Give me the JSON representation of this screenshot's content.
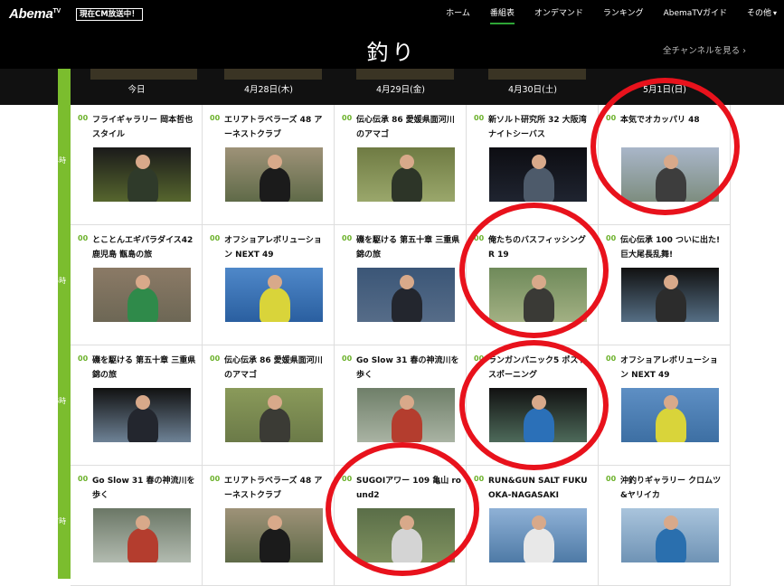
{
  "header": {
    "logo": "Abema",
    "logo_sup": "TV",
    "onair_badge": "現在CM放送中！",
    "nav": [
      {
        "label": "ホーム",
        "active": false
      },
      {
        "label": "番組表",
        "active": true
      },
      {
        "label": "オンデマンド",
        "active": false
      },
      {
        "label": "ランキング",
        "active": false
      },
      {
        "label": "AbemaTVガイド",
        "active": false
      },
      {
        "label": "その他",
        "active": false
      }
    ]
  },
  "page": {
    "title": "釣り",
    "all_channels": "全チャンネルを見る ›"
  },
  "dates": [
    "今日",
    "4月28日(木)",
    "4月29日(金)",
    "4月30日(土)",
    "5月1日(日)"
  ],
  "hours": [
    "4時",
    "5時",
    "6時",
    "7時"
  ],
  "rows": [
    [
      {
        "min": "00",
        "title": "フライギャラリー 岡本哲也スタイル",
        "thumb": {
          "bg": "#1a1a1a",
          "scene": "#56662e",
          "fig": "#2f3a2a"
        }
      },
      {
        "min": "00",
        "title": "エリアトラベラーズ 48 アーネストクラブ",
        "thumb": {
          "bg": "#9e9278",
          "scene": "#5f6a48",
          "fig": "#1b1b1b"
        }
      },
      {
        "min": "00",
        "title": "伝心伝承 86 愛媛県面河川のアマゴ",
        "thumb": {
          "bg": "#6f7b43",
          "scene": "#9aa76b",
          "fig": "#2d3528"
        }
      },
      {
        "min": "00",
        "title": "新ソルト研究所 32 大阪湾ナイトシーバス",
        "thumb": {
          "bg": "#0d0d12",
          "scene": "#1f2430",
          "fig": "#4d5a6a"
        }
      },
      {
        "min": "00",
        "title": "本気でオカッパリ 48",
        "thumb": {
          "bg": "#a9b6c9",
          "scene": "#7d8d7f",
          "fig": "#3d3d3d"
        }
      }
    ],
    [
      {
        "min": "00",
        "title": "とことんエギパラダイス42 鹿児島 甑島の旅",
        "thumb": {
          "bg": "#8b7a66",
          "scene": "#6d6755",
          "fig": "#2f8a4a"
        }
      },
      {
        "min": "00",
        "title": "オフショアレボリューション NEXT 49",
        "thumb": {
          "bg": "#4f88c9",
          "scene": "#2a5fa0",
          "fig": "#d9d43a"
        }
      },
      {
        "min": "00",
        "title": "磯を駆ける 第五十章 三重県錦の旅",
        "thumb": {
          "bg": "#3b5677",
          "scene": "#566c88",
          "fig": "#23262e"
        }
      },
      {
        "min": "00",
        "title": "俺たちのバスフィッシング R 19",
        "thumb": {
          "bg": "#6f8a5a",
          "scene": "#a2b083",
          "fig": "#3a3a36"
        }
      },
      {
        "min": "00",
        "title": "伝心伝承 100 ついに出た!巨大尾長乱舞!",
        "thumb": {
          "bg": "#111",
          "scene": "#556e84",
          "fig": "#2c2c2c"
        }
      }
    ],
    [
      {
        "min": "00",
        "title": "磯を駆ける 第五十章 三重県錦の旅",
        "thumb": {
          "bg": "#111",
          "scene": "#6e8296",
          "fig": "#23262e"
        }
      },
      {
        "min": "00",
        "title": "伝心伝承 86 愛媛県面河川のアマゴ",
        "thumb": {
          "bg": "#8a9a5a",
          "scene": "#6b7a48",
          "fig": "#3b3b35"
        }
      },
      {
        "min": "00",
        "title": "Go Slow 31 春の神流川を歩く",
        "thumb": {
          "bg": "#6f7f69",
          "scene": "#a9b3a3",
          "fig": "#b43d2e"
        }
      },
      {
        "min": "00",
        "title": "ランガンパニック5 ポストスポーニング",
        "thumb": {
          "bg": "#111",
          "scene": "#4d6a5a",
          "fig": "#2b70b8"
        }
      },
      {
        "min": "00",
        "title": "オフショアレボリューション NEXT 49",
        "thumb": {
          "bg": "#5e8fc4",
          "scene": "#3d6fa3",
          "fig": "#d9d43a"
        }
      }
    ],
    [
      {
        "min": "00",
        "title": "Go Slow 31 春の神流川を歩く",
        "thumb": {
          "bg": "#6b7766",
          "scene": "#b2bbb0",
          "fig": "#b43d2e"
        }
      },
      {
        "min": "00",
        "title": "エリアトラベラーズ 48 アーネストクラブ",
        "thumb": {
          "bg": "#9e9278",
          "scene": "#5f6a48",
          "fig": "#1b1b1b"
        }
      },
      {
        "min": "00",
        "title": "SUGOIアワー 109 亀山 round2",
        "thumb": {
          "bg": "#5a6e48",
          "scene": "#7f915f",
          "fig": "#d4d4d4"
        }
      },
      {
        "min": "00",
        "title": "RUN&GUN SALT FUKUOKA-NAGASAKI",
        "thumb": {
          "bg": "#8fb1d6",
          "scene": "#4e7aa6",
          "fig": "#e8e8e8"
        }
      },
      {
        "min": "00",
        "title": "沖釣りギャラリー クロムツ&ヤリイカ",
        "thumb": {
          "bg": "#a9c4dc",
          "scene": "#6f93b5",
          "fig": "#2a6fae"
        }
      }
    ]
  ],
  "accent": "#7bbd2e",
  "highlight": "#e8121c"
}
